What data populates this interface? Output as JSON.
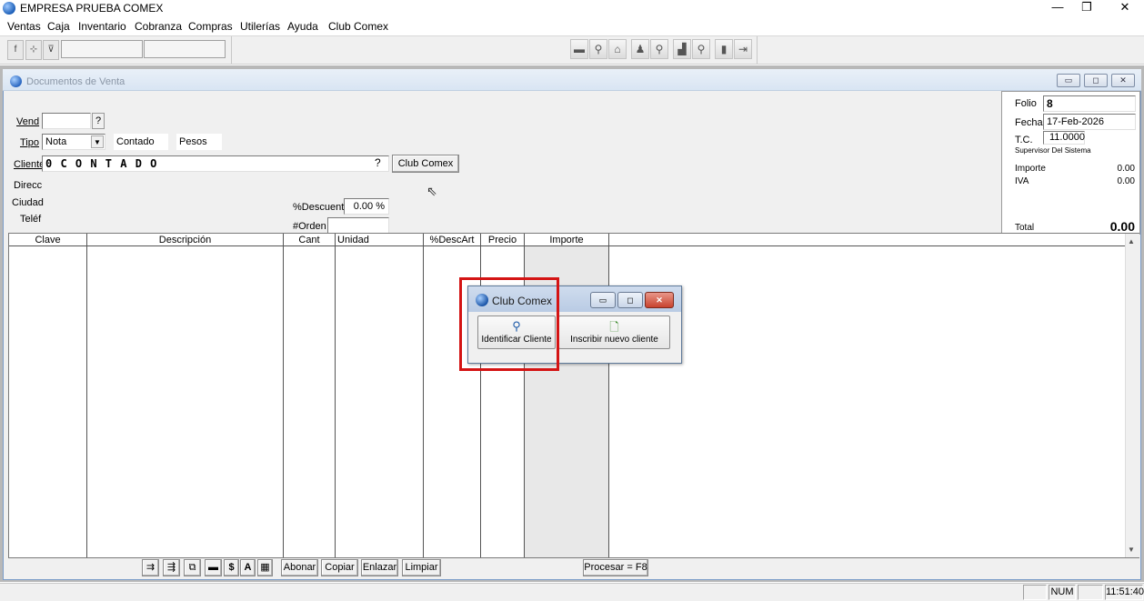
{
  "window": {
    "title": "EMPRESA PRUEBA COMEX",
    "minimize": "—",
    "maximize": "❐",
    "close": "✕"
  },
  "menu": [
    "Ventas",
    "Caja",
    "Inventario",
    "Cobranza",
    "Compras",
    "Utilerías",
    "Ayuda",
    "Club Comex"
  ],
  "toolbar": {
    "fx": "f",
    "btn2": "⊹",
    "btn3": "⊽"
  },
  "doc": {
    "title": "Documentos de Venta",
    "mdi_min": "▭",
    "mdi_max": "◻",
    "mdi_close": "✕",
    "labels": {
      "vend": "Vend",
      "tipo": "Tipo",
      "cliente": "Cliente",
      "direcc": "Direcc",
      "ciudad": "Ciudad",
      "telef": "Teléf",
      "descuent": "%Descuent",
      "orden": "#Orden"
    },
    "vend_value": "",
    "vend_help": "?",
    "tipo_value": "Nota",
    "contado": "Contado",
    "pesos": "Pesos",
    "cliente_value": "0 C O N T A D O",
    "cliente_help": "?",
    "club_button": "Club Comex",
    "descuent_value": "0.00 %",
    "orden_value": ""
  },
  "info": {
    "folio_label": "Folio",
    "folio": "8",
    "fecha_label": "Fecha",
    "fecha": "17-Feb-2026",
    "tc_label": "T.C.",
    "tc": "11.0000",
    "supervisor": "Supervisor Del Sistema",
    "importe_label": "Importe",
    "importe": "0.00",
    "iva_label": "IVA",
    "iva": "0.00",
    "total_label": "Total",
    "total": "0.00"
  },
  "grid": {
    "columns": [
      "Clave",
      "Descripción",
      "Cant",
      "Unidad",
      "%DescArt",
      "Precio",
      "Importe"
    ]
  },
  "bottom": {
    "icons": [
      "⇉",
      "⇶",
      "⧉",
      "▬",
      "$",
      "A",
      "▦"
    ],
    "abonar": "Abonar",
    "copiar": "Copiar",
    "enlazar": "Enlazar",
    "limpiar": "Limpiar",
    "procesar": "Procesar = F8"
  },
  "status": {
    "num": "NUM",
    "time": "11:51:40"
  },
  "dialog": {
    "title": "Club Comex",
    "min": "▭",
    "max": "◻",
    "close": "✕",
    "identify": "Identificar Cliente",
    "enroll": "Inscribir nuevo cliente"
  }
}
